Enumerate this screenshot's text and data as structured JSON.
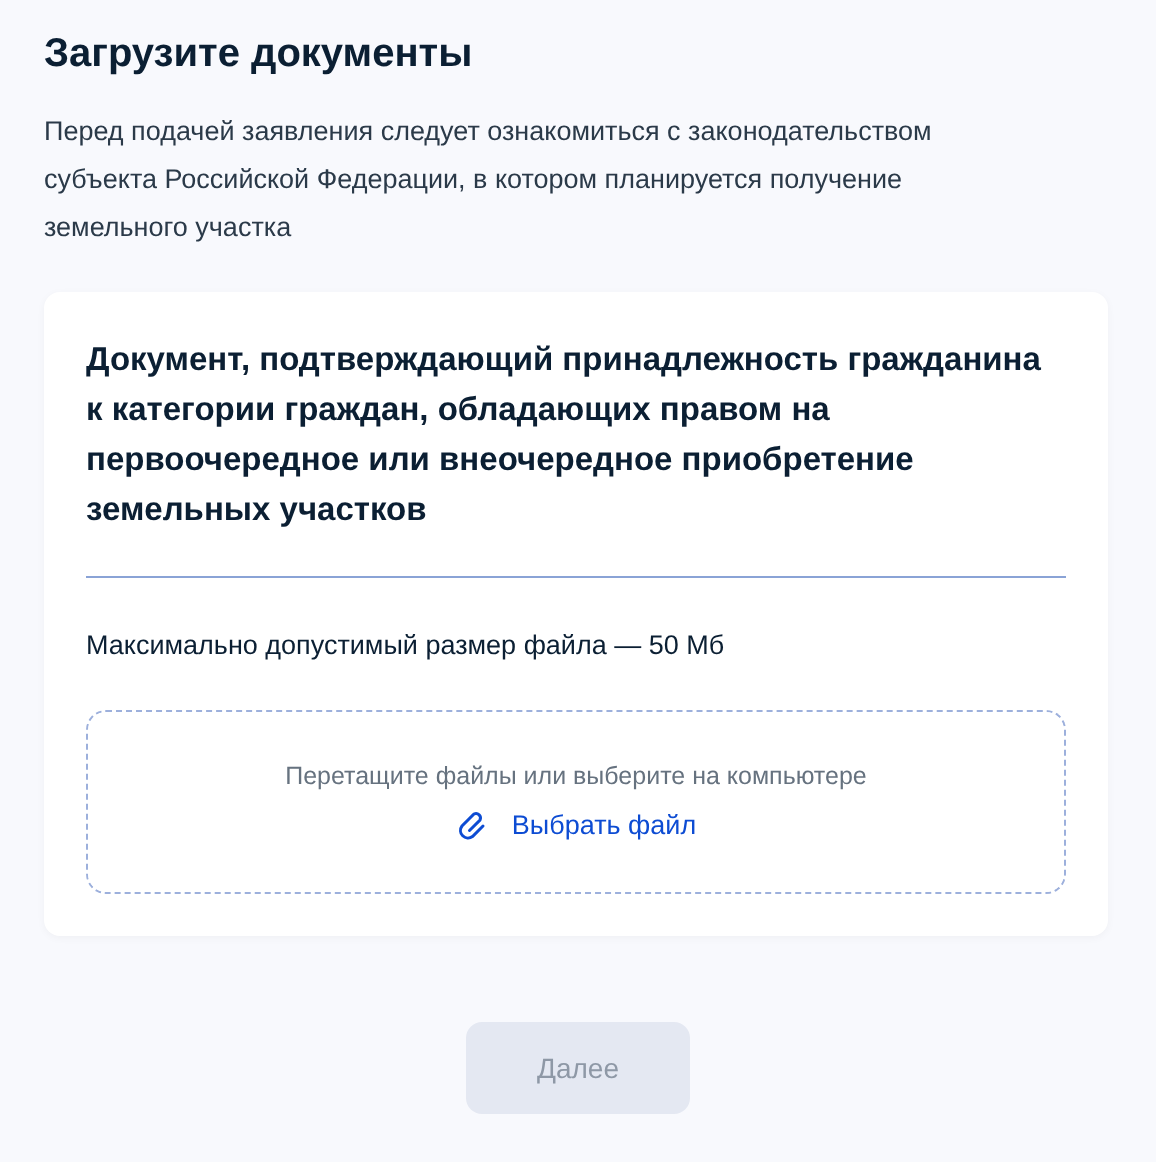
{
  "title": "Загрузите документы",
  "description": "Перед подачей заявления следует ознакомиться с законодательством субъекта Российской Федерации, в котором планируется получение земельного участка",
  "document": {
    "title": "Документ, подтверждающий принадлежность гражданина к категории граждан, обладающих правом на первоочередное или внеочередное приобретение земельных участков",
    "max_size": "Максимально допустимый размер файла — 50 Мб",
    "dropzone": {
      "hint": "Перетащите файлы или выберите на компьютере",
      "link": "Выбрать файл"
    }
  },
  "next_button": {
    "label": "Далее",
    "disabled": true
  }
}
